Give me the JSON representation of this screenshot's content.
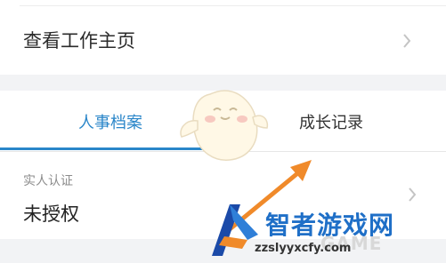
{
  "top_row": {
    "label": "查看工作主页"
  },
  "tabs": [
    {
      "label": "人事档案",
      "active": true
    },
    {
      "label": "成长记录",
      "active": false
    }
  ],
  "verification": {
    "label": "实人认证",
    "value": "未授权"
  },
  "watermark": {
    "brand": "智者游戏网",
    "url": "zzslyyxcfy.com",
    "overlay": "GAME"
  },
  "colors": {
    "accent": "#2a86c9",
    "arrow": "#f08a2a",
    "logo_blue": "#1f6fc7"
  }
}
